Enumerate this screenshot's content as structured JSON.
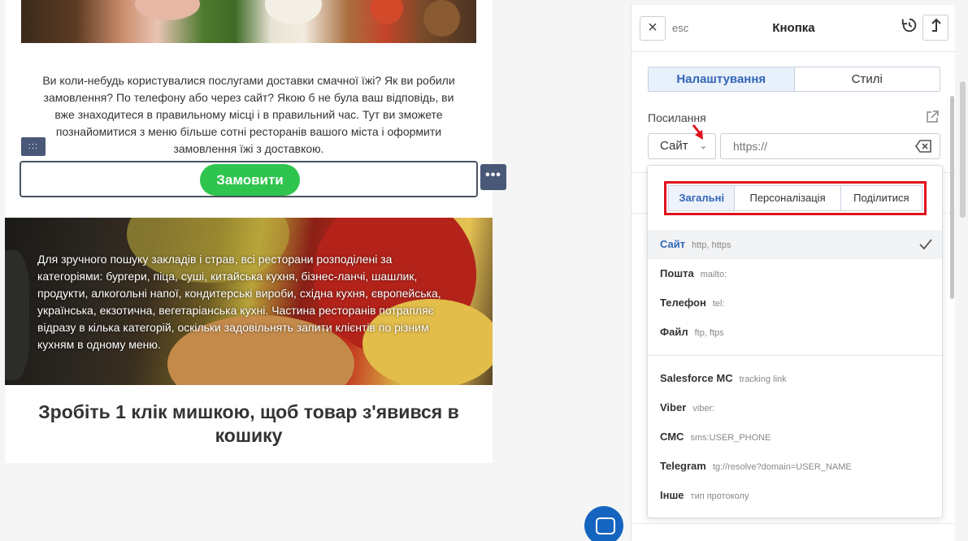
{
  "email": {
    "intro_text": "Ви коли-небудь користувалися послугами доставки смачної їжі? Як ви робили замовлення? По телефону або через сайт? Якою б не була ваш відповідь, ви вже знаходитеся в правильному місці і в правильний час. Тут ви зможете познайомитися з меню більше сотні ресторанів вашого міста і оформити замовлення їжі з доставкою.",
    "drag_handle": ":::",
    "order_button": "Замовити",
    "more_button": "•••",
    "categories_text": "Для зручного пошуку закладів і страв, всі ресторани розподілені за категоріями: бургери, піца, суші, китайська кухня, бізнес-ланчі, шашлик, продукти, алкогольні напої, кондитерські вироби, східна кухня, європейська, українська, екзотична, вегетаріанська кухні. Частина ресторанів потрапляє відразу в кілька категорій, оскільки задовільнять запити клієнтів по різним кухням в одному меню.",
    "click_title": "Зробіть 1 клік мишкою, щоб товар з'явився в кошику"
  },
  "panel": {
    "esc_label": "esc",
    "title": "Кнопка",
    "tabs": [
      {
        "label": "Налаштування",
        "active": true
      },
      {
        "label": "Стилі",
        "active": false
      }
    ],
    "link_label": "Посилання",
    "link_type": "Сайт",
    "url_placeholder": "https://"
  },
  "dropdown": {
    "segments": [
      {
        "label": "Загальні",
        "active": true
      },
      {
        "label": "Персоналізація",
        "active": false
      },
      {
        "label": "Поділитися",
        "active": false
      }
    ],
    "options_group1": [
      {
        "name": "Сайт",
        "hint": "http, https",
        "selected": true
      },
      {
        "name": "Пошта",
        "hint": "mailto:",
        "selected": false
      },
      {
        "name": "Телефон",
        "hint": "tel:",
        "selected": false
      },
      {
        "name": "Файл",
        "hint": "ftp, ftps",
        "selected": false
      }
    ],
    "options_group2": [
      {
        "name": "Salesforce MC",
        "hint": "tracking link"
      },
      {
        "name": "Viber",
        "hint": "viber:"
      },
      {
        "name": "СМС",
        "hint": "sms:USER_PHONE"
      },
      {
        "name": "Telegram",
        "hint": "tg://resolve?domain=USER_NAME"
      },
      {
        "name": "Інше",
        "hint": "тип протоколу"
      }
    ]
  },
  "colors": {
    "accent": "#3266b8",
    "order_button": "#2fc44e",
    "highlight_frame": "#e0121c",
    "chat_bubble": "#1565c0"
  }
}
